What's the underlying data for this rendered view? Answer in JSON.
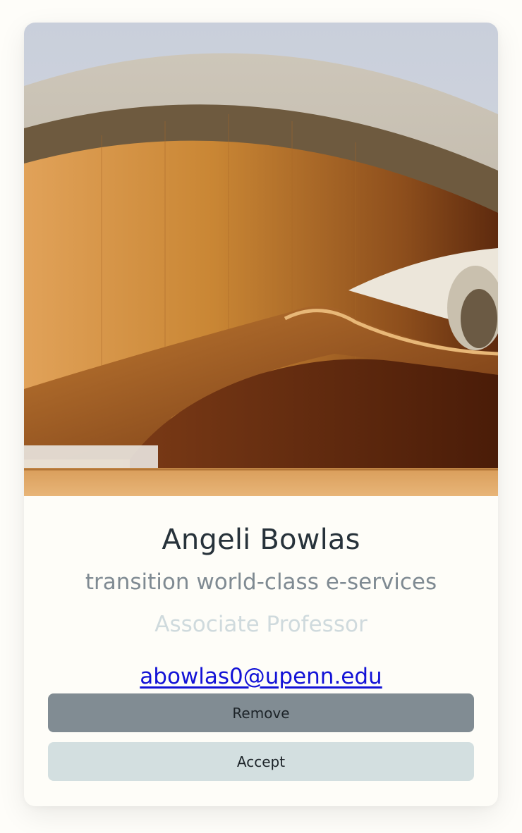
{
  "profile": {
    "photo_icon": "profile-photo",
    "name": "Angeli Bowlas",
    "tagline": "transition world-class e-services",
    "role": "Associate Professor",
    "email": "abowlas0@upenn.edu"
  },
  "actions": {
    "remove_label": "Remove",
    "accept_label": "Accept"
  },
  "colors": {
    "name_text": "#27323a",
    "tagline_text": "#7f8a92",
    "role_text": "#cfdadd",
    "email_link": "#1212d6",
    "remove_button": "#818c93",
    "accept_button": "#d3dfe0",
    "card_background": "#fefdf8"
  }
}
